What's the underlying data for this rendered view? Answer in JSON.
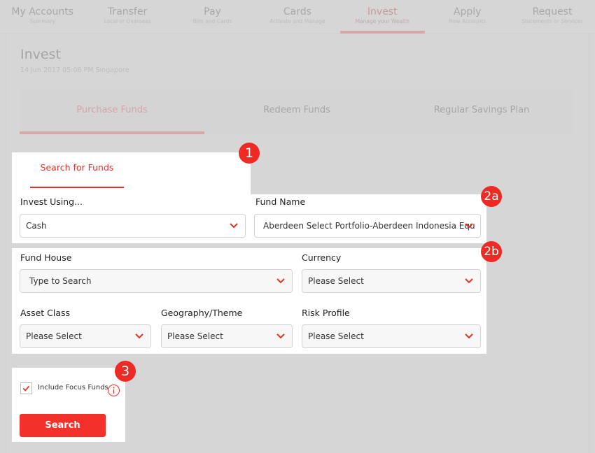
{
  "nav": {
    "items": [
      {
        "title": "My Accounts",
        "subtitle": "Summary",
        "active": false
      },
      {
        "title": "Transfer",
        "subtitle": "Local or Overseas",
        "active": false
      },
      {
        "title": "Pay",
        "subtitle": "Bills and Cards",
        "active": false
      },
      {
        "title": "Cards",
        "subtitle": "Activate and Manage",
        "active": false
      },
      {
        "title": "Invest",
        "subtitle": "Manage your Wealth",
        "active": true
      },
      {
        "title": "Apply",
        "subtitle": "New Accounts",
        "active": false
      },
      {
        "title": "Request",
        "subtitle": "Statements or Services",
        "active": false
      }
    ]
  },
  "page": {
    "title": "Invest",
    "datetime": "14 Jun 2017 05:06 PM Singapore"
  },
  "subtabs": [
    {
      "label": "Purchase Funds",
      "active": true
    },
    {
      "label": "Redeem Funds",
      "active": false
    },
    {
      "label": "Regular Savings Plan",
      "active": false
    }
  ],
  "colors": {
    "accent": "#e8302b",
    "badge": "#ee2a24",
    "button": "#f4302a",
    "overlay": "#d5d5d5"
  },
  "form": {
    "search_tab_label": "Search for Funds",
    "invest_using": {
      "label": "Invest Using...",
      "value": "Cash"
    },
    "fund_name": {
      "label": "Fund Name",
      "value": "Aberdeen Select Portfolio-Aberdeen Indonesia Equ"
    },
    "fund_house": {
      "label": "Fund House",
      "placeholder": "Type to Search"
    },
    "currency": {
      "label": "Currency",
      "value": "Please Select"
    },
    "asset_class": {
      "label": "Asset Class",
      "value": "Please Select"
    },
    "geography": {
      "label": "Geography/Theme",
      "value": "Please Select"
    },
    "risk_profile": {
      "label": "Risk Profile",
      "value": "Please Select"
    },
    "focus_funds": {
      "label": "Include Focus Funds",
      "checked": true
    },
    "search_button": "Search"
  },
  "badges": {
    "b1": "1",
    "b2a": "2a",
    "b2b": "2b",
    "b3": "3"
  }
}
